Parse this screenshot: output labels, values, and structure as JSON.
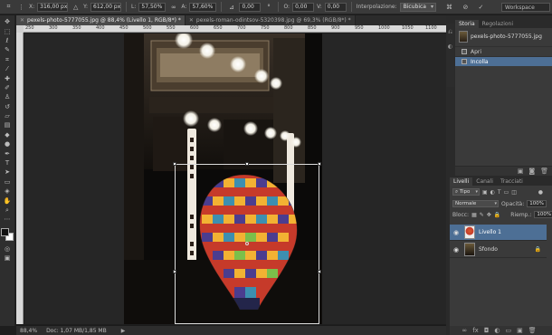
{
  "options_bar": {
    "x_label": "X:",
    "x_value": "316,00 px",
    "y_label": "Y:",
    "y_value": "612,00 px",
    "w_label": "L:",
    "w_value": "57,50%",
    "h_label": "A:",
    "h_value": "57,60%",
    "rotate_value": "0,00",
    "hskew_label": "O:",
    "hskew_value": "0,00",
    "vskew_label": "V:",
    "vskew_value": "0,00",
    "interp_label": "Interpolazione:",
    "interp_value": "Bicubica",
    "workspace_label": "Workspace"
  },
  "tabs": [
    {
      "label": "pexels-photo-5777055.jpg @ 88,4% (Livello 1, RGB/8*) *",
      "active": true
    },
    {
      "label": "pexels-roman-odintsov-5320398.jpg @ 69,3% (RGB/8*) *",
      "active": false
    }
  ],
  "ruler_ticks": [
    "250",
    "300",
    "350",
    "400",
    "450",
    "500",
    "550",
    "600",
    "650",
    "700",
    "750",
    "800",
    "850",
    "900",
    "950",
    "1000",
    "1050",
    "1100"
  ],
  "status": {
    "zoom": "88,4%",
    "doc": "Doc: 1,07 MB/1,85 MB"
  },
  "history_panel": {
    "tabs": [
      "Storia",
      "Regolazioni"
    ],
    "document": "pexels-photo-5777055.jpg",
    "items": [
      {
        "label": "Apri",
        "active": false
      },
      {
        "label": "Incolla",
        "active": true
      }
    ]
  },
  "layers_panel": {
    "tabs": [
      "Livelli",
      "Canali",
      "Tracciati"
    ],
    "filter_label": "Tipo",
    "blend_mode": "Normale",
    "opacity_label": "Opacità:",
    "opacity_value": "100%",
    "lock_label": "Blocc:",
    "fill_label": "Riemp.:",
    "fill_value": "100%",
    "layers": [
      {
        "name": "Livello 1",
        "active": true
      },
      {
        "name": "Sfondo",
        "active": false
      }
    ]
  },
  "colors": {
    "accent": "#4d6f95"
  }
}
